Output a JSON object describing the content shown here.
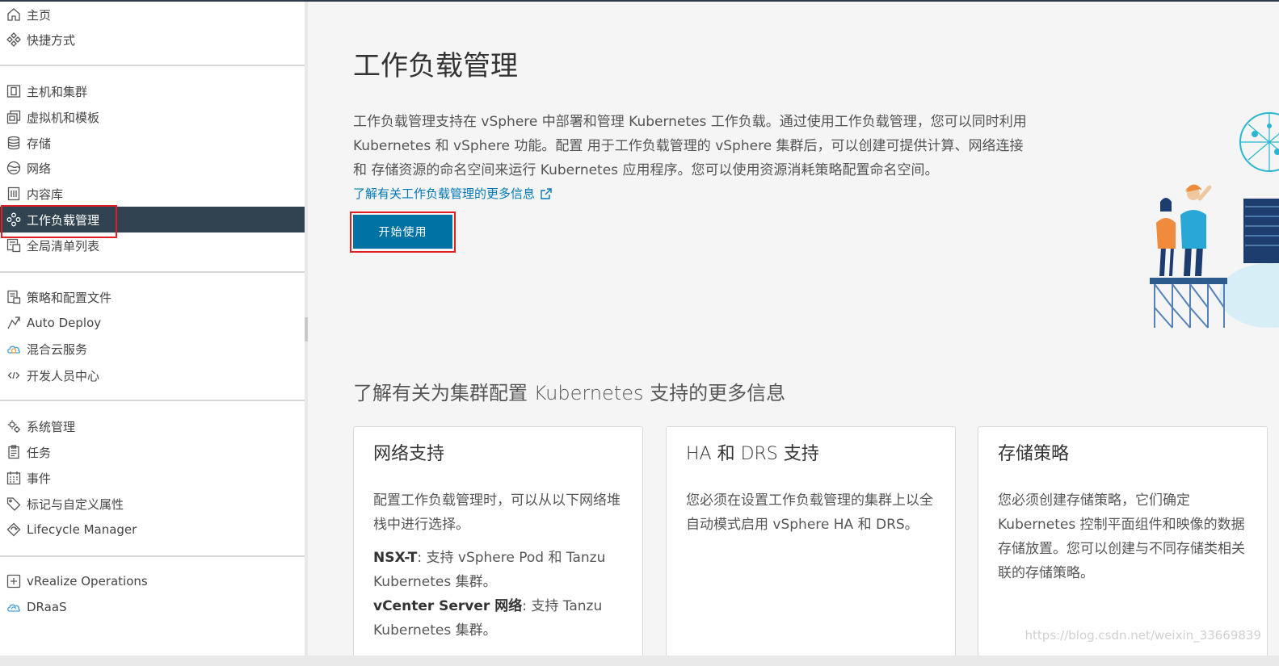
{
  "sidebar": {
    "items": [
      {
        "label": "主页",
        "icon": "home-icon"
      },
      {
        "label": "快捷方式",
        "icon": "shortcuts-icon"
      },
      {
        "label": "主机和集群",
        "icon": "hosts-clusters-icon"
      },
      {
        "label": "虚拟机和模板",
        "icon": "vms-templates-icon"
      },
      {
        "label": "存储",
        "icon": "storage-icon"
      },
      {
        "label": "网络",
        "icon": "network-icon"
      },
      {
        "label": "内容库",
        "icon": "content-library-icon"
      },
      {
        "label": "工作负载管理",
        "icon": "workload-management-icon",
        "active": true
      },
      {
        "label": "全局清单列表",
        "icon": "global-inventory-icon"
      },
      {
        "label": "策略和配置文件",
        "icon": "policies-profiles-icon"
      },
      {
        "label": "Auto Deploy",
        "icon": "auto-deploy-icon"
      },
      {
        "label": "混合云服务",
        "icon": "hybrid-cloud-icon"
      },
      {
        "label": "开发人员中心",
        "icon": "developer-center-icon"
      },
      {
        "label": "系统管理",
        "icon": "administration-icon"
      },
      {
        "label": "任务",
        "icon": "tasks-icon"
      },
      {
        "label": "事件",
        "icon": "events-icon"
      },
      {
        "label": "标记与自定义属性",
        "icon": "tags-icon"
      },
      {
        "label": "Lifecycle Manager",
        "icon": "lifecycle-manager-icon"
      },
      {
        "label": "vRealize Operations",
        "icon": "vrealize-operations-icon"
      },
      {
        "label": "DRaaS",
        "icon": "draas-icon"
      }
    ]
  },
  "main": {
    "title": "工作负载管理",
    "description": "工作负载管理支持在 vSphere 中部署和管理 Kubernetes 工作负载。通过使用工作负载管理，您可以同时利用 Kubernetes 和 vSphere 功能。配置 用于工作负载管理的 vSphere 集群后，可以创建可提供计算、网络连接和 存储资源的命名空间来运行 Kubernetes 应用程序。您可以使用资源消耗策略配置命名空间。",
    "learn_more_link": "了解有关工作负载管理的更多信息",
    "start_button": "开始使用",
    "section_title": "了解有关为集群配置 Kubernetes 支持的更多信息",
    "cards": [
      {
        "title": "网络支持",
        "intro": "配置工作负载管理时，可以从以下网络堆栈中进行选择。",
        "nsx_label": "NSX-T",
        "nsx_text": ": 支持 vSphere Pod 和 Tanzu Kubernetes 集群。",
        "vcenter_label": "vCenter Server 网络",
        "vcenter_text": ": 支持 Tanzu Kubernetes 集群。"
      },
      {
        "title": "HA 和 DRS 支持",
        "body": "您必须在设置工作负载管理的集群上以全自动模式启用 vSphere HA 和 DRS。"
      },
      {
        "title": "存储策略",
        "body": "您必须创建存储策略，它们确定 Kubernetes 控制平面组件和映像的数据存储放置。您可以创建与不同存储类相关联的存储策略。"
      }
    ]
  },
  "watermark": "https://blog.csdn.net/weixin_33669839",
  "colors": {
    "accent": "#0072a3",
    "link": "#0079b8",
    "sidebar_active": "#314351",
    "highlight_box": "#e02020"
  }
}
